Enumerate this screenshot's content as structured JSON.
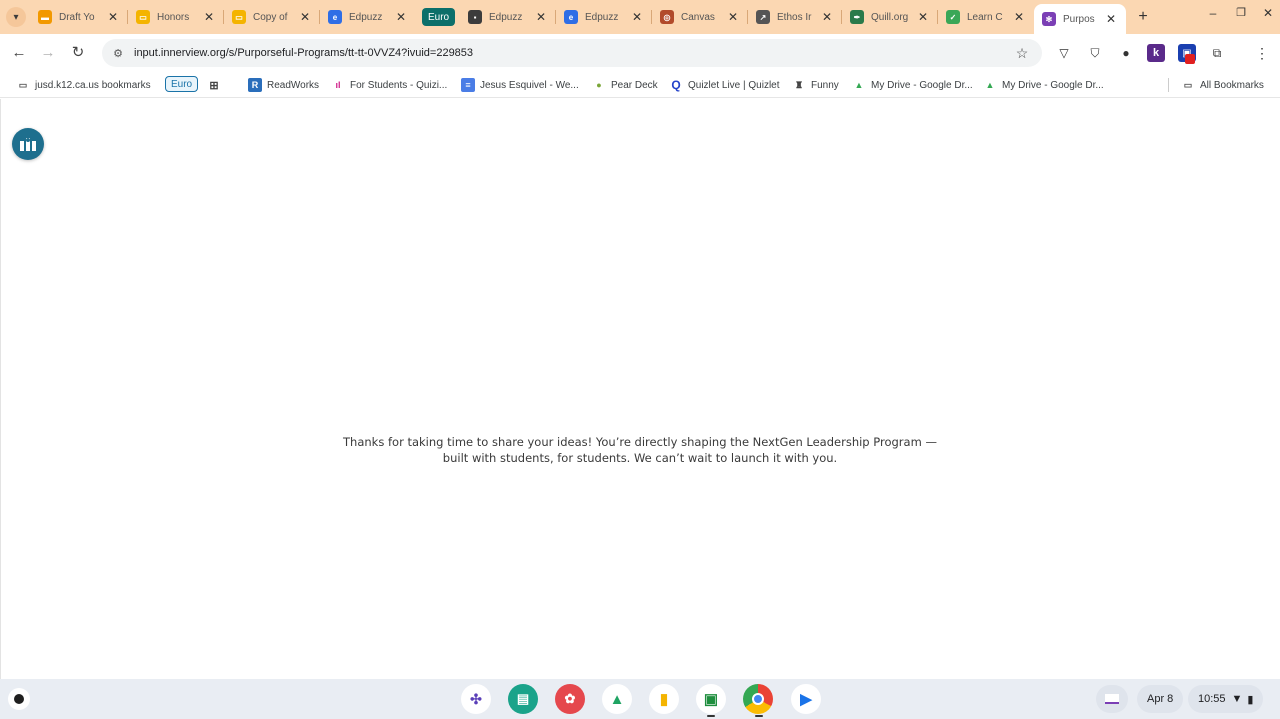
{
  "tabs": [
    {
      "title": "Draft Yo",
      "icon": "slides-icon",
      "color": "#f29900",
      "glyph": "▬"
    },
    {
      "title": "Honors",
      "icon": "slides-icon",
      "color": "#f4b400",
      "glyph": "▭"
    },
    {
      "title": "Copy of",
      "icon": "slides-icon",
      "color": "#f4b400",
      "glyph": "▭"
    },
    {
      "title": "Edpuzz",
      "icon": "edpuzzle-icon",
      "color": "#2f6ee6",
      "glyph": "e"
    },
    {
      "title": "Edpuzz",
      "icon": "classroom-icon",
      "color": "#3c3c3c",
      "glyph": "▪"
    },
    {
      "title": "Edpuzz",
      "icon": "edpuzzle-icon",
      "color": "#2f6ee6",
      "glyph": "e"
    },
    {
      "title": "Canvas",
      "icon": "canvas-icon",
      "color": "#b24b2b",
      "glyph": "◎"
    },
    {
      "title": "Ethos Ir",
      "icon": "chart-icon",
      "color": "#555555",
      "glyph": "↗"
    },
    {
      "title": "Quill.org",
      "icon": "quill-icon",
      "color": "#2a7a4a",
      "glyph": "✒"
    },
    {
      "title": "Learn C",
      "icon": "check-icon",
      "color": "#3aa757",
      "glyph": "✓"
    },
    {
      "title": "Purpos",
      "icon": "innerview-icon",
      "color": "#7b3fb5",
      "glyph": "✻"
    }
  ],
  "tab_group_label": "Euro",
  "url": "input.innerview.org/s/Purporseful-Programs/tt-tt-0VVZ4?ivuid=229853",
  "bookmarks": [
    {
      "label": "jusd.k12.ca.us bookmarks",
      "icon": "folder-icon"
    },
    {
      "label": "ReadWorks",
      "icon": "readworks-icon"
    },
    {
      "label": "For Students - Quizi...",
      "icon": "quizizz-icon"
    },
    {
      "label": "Jesus Esquivel - We...",
      "icon": "docs-icon"
    },
    {
      "label": "Pear Deck",
      "icon": "pear-icon"
    },
    {
      "label": "Quizlet Live | Quizlet",
      "icon": "quizlet-icon"
    },
    {
      "label": "Funny",
      "icon": "funny-icon"
    },
    {
      "label": "My Drive - Google Dr...",
      "icon": "drive-icon"
    },
    {
      "label": "My Drive - Google Dr...",
      "icon": "drive-icon"
    },
    {
      "label": "All Bookmarks",
      "icon": "folder-icon"
    }
  ],
  "bookmark_group_chip": "Euro",
  "message_line1": "Thanks for taking  time to share your ideas! You’re directly shaping the NextGen Leadership Program —",
  "message_line2": "built with students, for students. We can’t wait to launch it with you.",
  "shelf": {
    "date": "Apr 8",
    "time": "10:55"
  },
  "colors": {
    "tabstrip": "#fbd7b2",
    "tab_group": "#0c6f6a",
    "innerview_logo": "#1e6f8e"
  }
}
